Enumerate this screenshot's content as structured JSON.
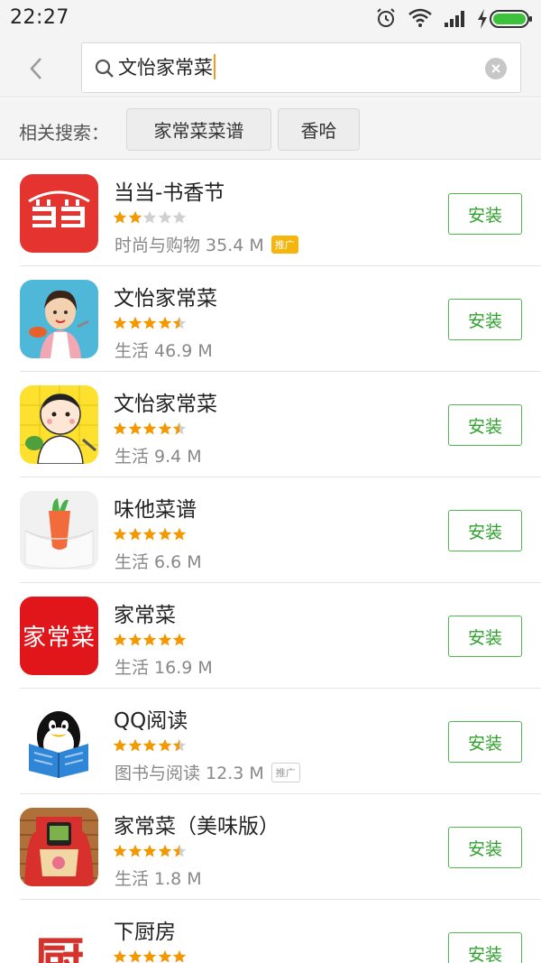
{
  "status_bar": {
    "time": "22:27"
  },
  "search": {
    "value": "文怡家常菜"
  },
  "related": {
    "label": "相关搜索：",
    "chips": [
      "家常菜菜谱",
      "香哈"
    ]
  },
  "apps": [
    {
      "name": "当当-书香节",
      "meta": "时尚与购物 35.4 M",
      "badge": "推广",
      "rating": 2,
      "button": "安装"
    },
    {
      "name": "文怡家常菜",
      "meta": "生活 46.9 M",
      "badge": "",
      "rating": 4.5,
      "button": "安装"
    },
    {
      "name": "文怡家常菜",
      "meta": "生活 9.4 M",
      "badge": "",
      "rating": 4.5,
      "button": "安装"
    },
    {
      "name": "味他菜谱",
      "meta": "生活 6.6 M",
      "badge": "",
      "rating": 5,
      "button": "安装"
    },
    {
      "name": "家常菜",
      "meta": "生活 16.9 M",
      "badge": "",
      "rating": 5,
      "button": "安装",
      "icon_text": "家常菜"
    },
    {
      "name": "QQ阅读",
      "meta": "图书与阅读 12.3 M",
      "badge": "推广",
      "rating": 4.5,
      "button": "安装"
    },
    {
      "name": "家常菜（美味版）",
      "meta": "生活 1.8 M",
      "badge": "",
      "rating": 4.5,
      "button": "安装"
    },
    {
      "name": "下厨房",
      "meta": "",
      "badge": "",
      "rating": 5,
      "button": "安装",
      "icon_text": "厨"
    }
  ],
  "colors": {
    "accent_green": "#2fa12c",
    "star_orange": "#f39800",
    "star_empty": "#d0d0d0",
    "ad_yellow": "#f5b50c"
  }
}
